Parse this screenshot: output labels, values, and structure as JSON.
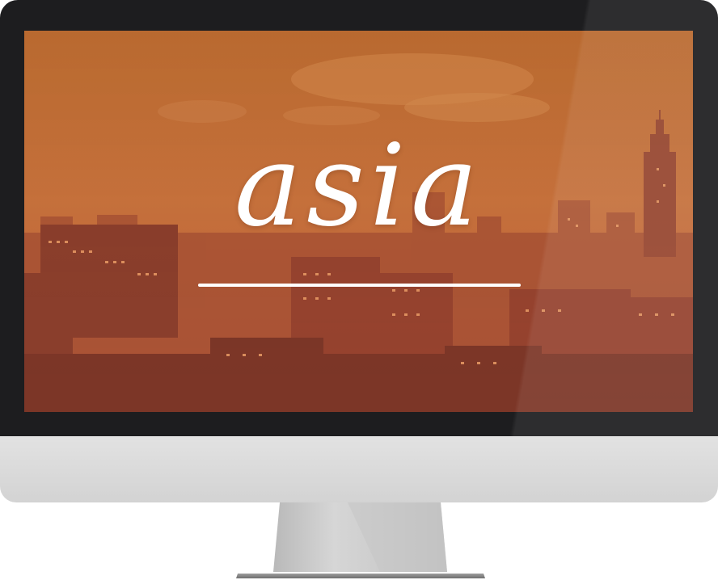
{
  "screen": {
    "headline": "asia"
  },
  "colors": {
    "bezel": "#1d1d1f",
    "chin": "#d8d8d8",
    "screen_tint": "#c57a3a",
    "headline": "#ffffff"
  }
}
